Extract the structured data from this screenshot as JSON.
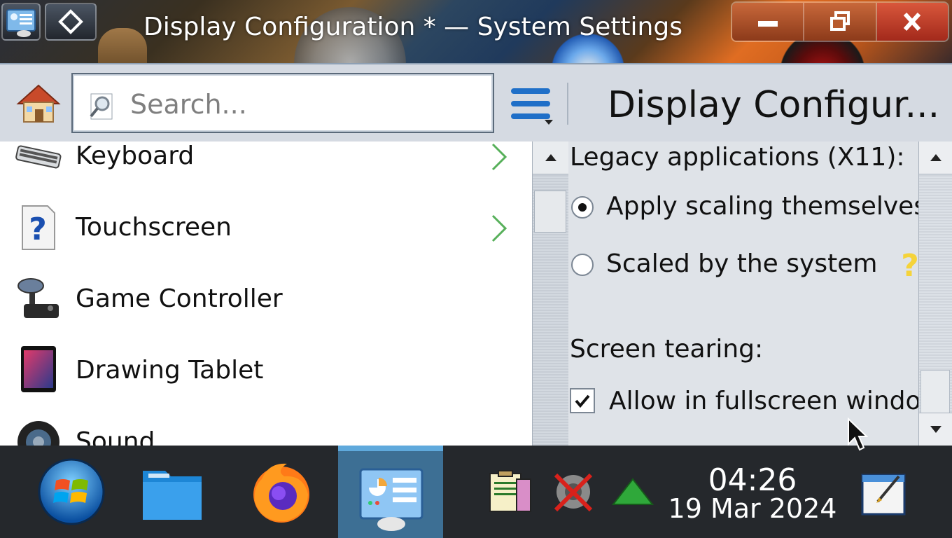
{
  "window": {
    "title": "Display Configuration * — System Settings"
  },
  "toolbar": {
    "search_placeholder": "Search...",
    "page_title": "Display Configur..."
  },
  "sidebar": {
    "items": [
      {
        "label": "Keyboard",
        "icon": "keyboard-icon",
        "has_children": true
      },
      {
        "label": "Touchscreen",
        "icon": "help-question-icon",
        "has_children": true
      },
      {
        "label": "Game Controller",
        "icon": "joystick-icon",
        "has_children": false
      },
      {
        "label": "Drawing Tablet",
        "icon": "tablet-icon",
        "has_children": false
      },
      {
        "label": "Sound",
        "icon": "speaker-icon",
        "has_children": false
      }
    ]
  },
  "content": {
    "legacy_heading": "Legacy applications (X11):",
    "option_apply": "Apply scaling themselves",
    "option_scaled": "Scaled by the system",
    "selected_option": "Apply scaling themselves",
    "tearing_heading": "Screen tearing:",
    "allow_fullscreen": "Allow in fullscreen windows",
    "allow_fullscreen_checked": true
  },
  "taskbar": {
    "apps": [
      "start-menu",
      "file-manager",
      "firefox",
      "system-settings"
    ],
    "active_app": "system-settings",
    "tray": [
      "clipboard-icon",
      "audio-muted-icon",
      "network-up-icon"
    ],
    "time": "04:26",
    "date": "19 Mar 2024"
  },
  "colors": {
    "accent": "#1f6fc8",
    "taskbar_bg": "#25282c",
    "active_task": "#3d6f94"
  }
}
